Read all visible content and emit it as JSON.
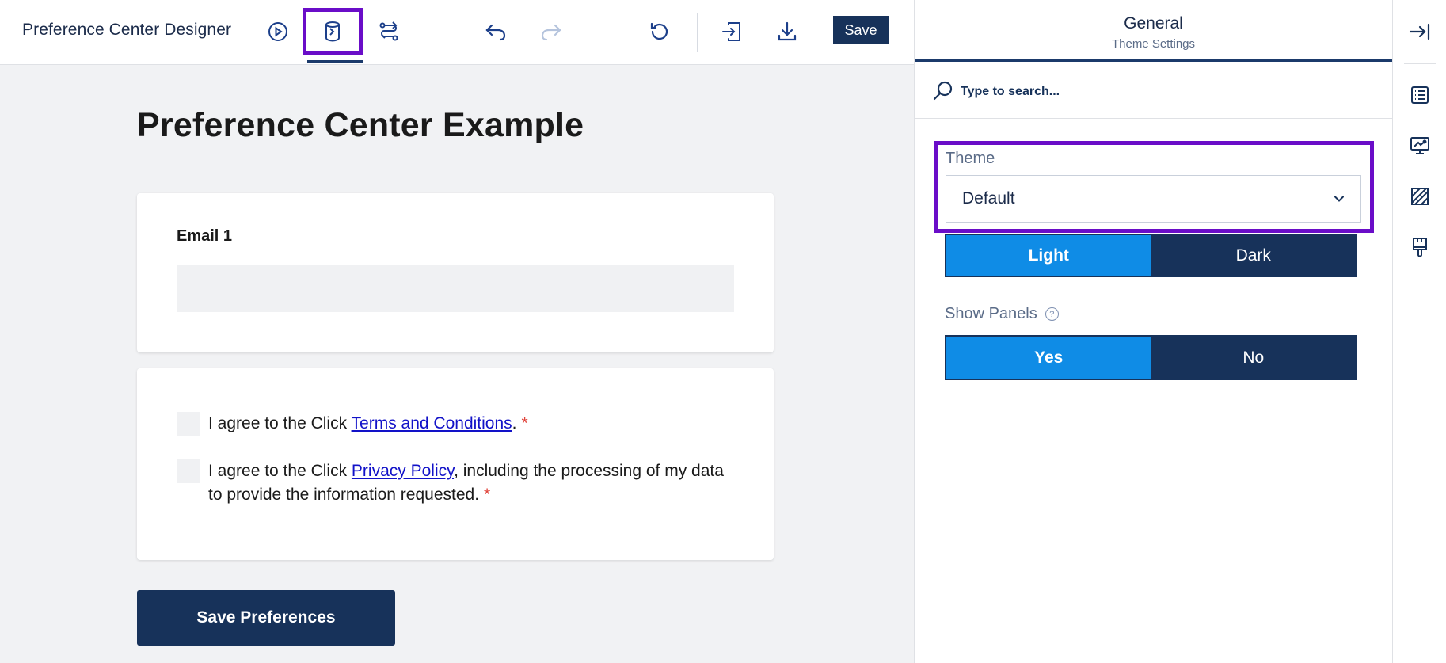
{
  "app": {
    "title": "Preference Center Designer"
  },
  "toolbar": {
    "preview_icon": "play-circle-icon",
    "data_icon": "database-icon",
    "flow_icon": "route-icon",
    "undo_icon": "undo-icon",
    "redo_icon": "redo-icon",
    "reset_icon": "reset-icon",
    "import_icon": "import-icon",
    "download_icon": "download-icon",
    "save_label": "Save"
  },
  "form": {
    "title": "Preference Center Example",
    "email_label": "Email 1",
    "email_value": "",
    "terms": {
      "prefix": "I agree to the Click ",
      "link": "Terms and Conditions",
      "suffix": ".",
      "required": "*"
    },
    "privacy": {
      "prefix": "I agree to the Click ",
      "link": "Privacy Policy",
      "suffix": ", including the processing of my data to provide the information requested.",
      "required": "*"
    },
    "submit_label": "Save Preferences"
  },
  "panel": {
    "title": "General",
    "subtitle": "Theme Settings",
    "search_placeholder": "Type to search...",
    "theme_label": "Theme",
    "theme_value": "Default",
    "mode_options": [
      "Light",
      "Dark"
    ],
    "mode_selected": "Light",
    "show_panels_label": "Show Panels",
    "show_panels_help": "?",
    "show_panels_options": [
      "Yes",
      "No"
    ],
    "show_panels_selected": "Yes"
  },
  "rail": {
    "collapse_icon": "collapse-right-icon",
    "items": [
      "list-icon",
      "presentation-icon",
      "pattern-icon",
      "paint-brush-icon"
    ]
  },
  "colors": {
    "navy": "#17325a",
    "active_blue": "#0f8ce6",
    "highlight": "#6a0dc8",
    "link": "#1212c8",
    "required": "#e0433a",
    "canvas": "#f1f2f4"
  }
}
